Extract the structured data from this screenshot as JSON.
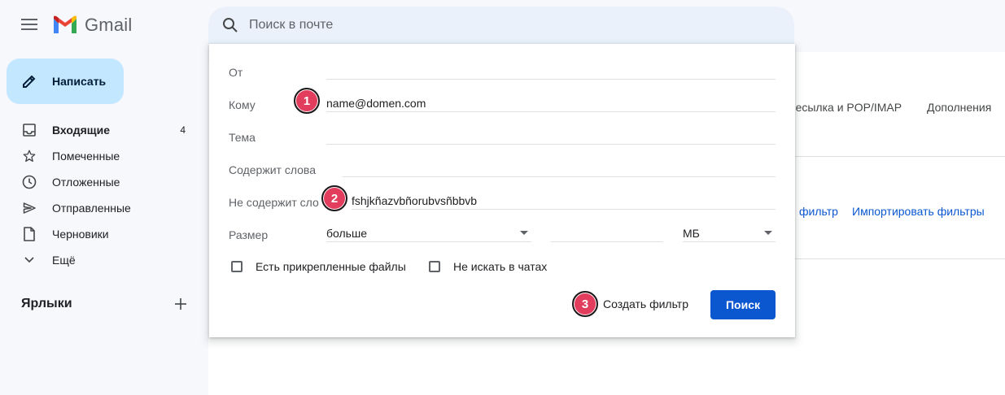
{
  "app": {
    "name": "Gmail",
    "colors": {
      "accent": "#0b57d0",
      "compose_bg": "#c2e7ff",
      "badge": "#e23d5c",
      "search_bg": "#eaf1fb"
    }
  },
  "header": {
    "search_placeholder": "Поиск в почте",
    "menu_icon": "hamburger-icon",
    "search_icon": "search-icon"
  },
  "sidebar": {
    "compose_label": "Написать",
    "items": [
      {
        "label": "Входящие",
        "icon": "inbox-icon",
        "count": "4",
        "bold": true
      },
      {
        "label": "Помеченные",
        "icon": "star-icon"
      },
      {
        "label": "Отложенные",
        "icon": "clock-icon"
      },
      {
        "label": "Отправленные",
        "icon": "send-icon"
      },
      {
        "label": "Черновики",
        "icon": "draft-icon"
      },
      {
        "label": "Ещё",
        "icon": "chevron-down-icon"
      }
    ],
    "labels_title": "Ярлыки"
  },
  "background": {
    "tab_forwarding": "ересылка и POP/IMAP",
    "tab_addons": "Дополнения",
    "link_filter": "фильтр",
    "link_import": "Импортировать фильтры"
  },
  "filter_dialog": {
    "from_label": "От",
    "from_value": "",
    "to_label": "Кому",
    "to_value": "name@domen.com",
    "subject_label": "Тема",
    "subject_value": "",
    "has_words_label": "Содержит слова",
    "has_words_value": "",
    "not_has_label": "Не содержит сло",
    "not_has_value": "fshjkñazvbñorubvsñbbvb",
    "size_label": "Размер",
    "size_operator": "больше",
    "size_value": "",
    "size_unit": "МБ",
    "has_attachment_label": "Есть прикрепленные файлы",
    "no_chats_label": "Не искать в чатах",
    "create_filter_label": "Создать фильтр",
    "search_button_label": "Поиск"
  },
  "annotations": {
    "badge_1": "1",
    "badge_2": "2",
    "badge_3": "3"
  }
}
